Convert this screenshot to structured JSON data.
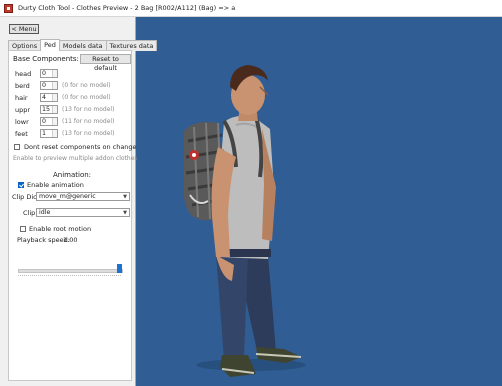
{
  "window": {
    "title": "Durty Cloth Tool - Clothes Preview - 2 Bag [R002/A112] (Bag) => a"
  },
  "menu_label": "< Menu",
  "tabs": [
    "Options",
    "Ped",
    "Models data",
    "Textures data"
  ],
  "base_components": {
    "heading": "Base Components:",
    "reset_label": "Reset to default",
    "rows": [
      {
        "label": "head",
        "value": "0",
        "hint": ""
      },
      {
        "label": "berd",
        "value": "0",
        "hint": "(0 for no model)"
      },
      {
        "label": "hair",
        "value": "4",
        "hint": "(0 for no model)"
      },
      {
        "label": "uppr",
        "value": "15",
        "hint": "(13 for no model)"
      },
      {
        "label": "lowr",
        "value": "0",
        "hint": "(11 for no model)"
      },
      {
        "label": "feet",
        "value": "1",
        "hint": "(13 for no model)"
      }
    ],
    "dont_reset_label": "Dont reset components on change",
    "dont_reset_checked": false,
    "note": "Enable to preview multiple addon clothes"
  },
  "animation": {
    "heading": "Animation:",
    "enable_label": "Enable animation",
    "enable_checked": true,
    "clip_dict_label": "Clip Dict:",
    "clip_dict_value": "move_m@generic",
    "clip_label": "Clip:",
    "clip_value": "idle",
    "root_motion_label": "Enable root motion",
    "root_motion_checked": false,
    "speed_label": "Playback speed:",
    "speed_value": "1.00",
    "speed_fraction": 1.0
  },
  "colors": {
    "viewport_bg": "#305d94",
    "accent": "#0a64c8"
  }
}
